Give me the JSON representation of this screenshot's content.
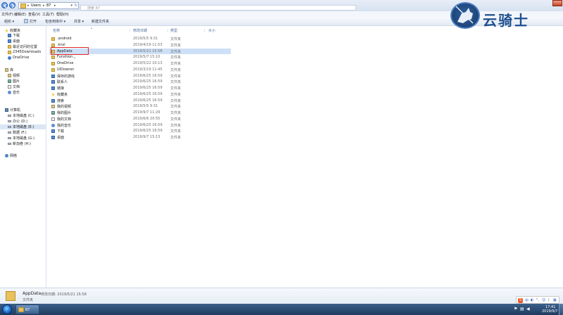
{
  "address": {
    "crumbs": [
      "Users",
      "87"
    ],
    "search_placeholder": "搜索 87"
  },
  "menu": [
    "文件(F)",
    "编辑(E)",
    "查看(V)",
    "工具(T)",
    "帮助(H)"
  ],
  "toolbar": {
    "organize": "组织 ▾",
    "open": "打开",
    "include": "包含到库中 ▾",
    "share": "共享 ▾",
    "new_folder": "新建文件夹"
  },
  "sidebar": {
    "favorites": [
      "收藏夹",
      "下载",
      "桌面",
      "最近访问的位置",
      "2345Downloads",
      "OneDrive"
    ],
    "library": [
      "库",
      "视频",
      "图片",
      "文档",
      "音乐"
    ],
    "computer": [
      "计算机",
      "本地磁盘 (C:)",
      "办公 (D:)",
      "本地磁盘 (E:)",
      "数据 (F:)",
      "本地磁盘 (G:)",
      "新加卷 (H:)"
    ],
    "network": "网络"
  },
  "columns": {
    "name": "名称",
    "date": "修改日期",
    "type": "类型",
    "size": "大小"
  },
  "files": [
    {
      "name": ".android",
      "date": "2019/5/5 9:31",
      "type": "文件夹",
      "icon": "folder-icon"
    },
    {
      "name": ".knsl",
      "date": "2019/4/19 11:53",
      "type": "文件夹",
      "icon": "folder-icon"
    },
    {
      "name": "AppData",
      "date": "2019/5/21 15:58",
      "type": "文件夹",
      "icon": "folder-icon"
    },
    {
      "name": "Funshion",
      "date": "2019/5/7 15:10",
      "type": "文件夹",
      "icon": "folder-icon"
    },
    {
      "name": "OneDrive",
      "date": "2019/5/22 10:13",
      "type": "文件夹",
      "icon": "folder-icon"
    },
    {
      "name": "UIDowner",
      "date": "2019/3/19 11:45",
      "type": "文件夹",
      "icon": "folder-icon"
    },
    {
      "name": "保存的游戏",
      "date": "2019/6/25 16:59",
      "type": "文件夹",
      "icon": "saved-games-icon"
    },
    {
      "name": "联系人",
      "date": "2019/6/25 16:59",
      "type": "文件夹",
      "icon": "contacts-icon"
    },
    {
      "name": "链接",
      "date": "2019/6/25 16:59",
      "type": "文件夹",
      "icon": "links-icon"
    },
    {
      "name": "收藏夹",
      "date": "2019/6/25 16:59",
      "type": "文件夹",
      "icon": "favorites-icon"
    },
    {
      "name": "搜索",
      "date": "2019/6/25 16:59",
      "type": "文件夹",
      "icon": "searches-icon"
    },
    {
      "name": "我的视频",
      "date": "2019/5/5 9:31",
      "type": "文件夹",
      "icon": "videos-icon"
    },
    {
      "name": "我的图片",
      "date": "2019/9/7 11:29",
      "type": "文件夹",
      "icon": "pictures-icon"
    },
    {
      "name": "我的文档",
      "date": "2019/6/6 20:55",
      "type": "文件夹",
      "icon": "documents-icon"
    },
    {
      "name": "我的音乐",
      "date": "2019/6/25 16:59",
      "type": "文件夹",
      "icon": "music-icon"
    },
    {
      "name": "下载",
      "date": "2019/6/25 16:59",
      "type": "文件夹",
      "icon": "downloads-icon"
    },
    {
      "name": "桌面",
      "date": "2019/9/7 15:13",
      "type": "文件夹",
      "icon": "desktop-icon"
    }
  ],
  "selected_file": "AppData",
  "details": {
    "name": "AppData",
    "meta": "修改日期: 2019/5/21 15:58",
    "type": "文件夹"
  },
  "taskbar": {
    "window_label": "87",
    "time": "17:41",
    "date": "2019/9/7"
  },
  "ime": {
    "s_label": "S",
    "lang": "中"
  },
  "watermark": "云骑士"
}
